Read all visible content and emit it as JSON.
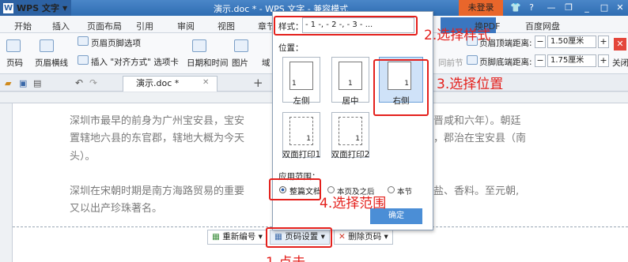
{
  "app": {
    "name": "WPS 文字",
    "doc_title": "演示.doc * - WPS 文字 - 兼容模式",
    "login": "未登录"
  },
  "tabs": [
    "开始",
    "插入",
    "页面布局",
    "引用",
    "审阅",
    "视图",
    "章节",
    "换PDF",
    "百度网盘"
  ],
  "ribbon": {
    "page_number": "页码",
    "header_footer": "页眉横线",
    "header_footer_option": "页眉页脚选项",
    "insert_align_tab": "插入 \"对齐方式\" 选项卡",
    "date_time": "日期和时间",
    "picture": "图片",
    "field": "域",
    "same_prev": "同前节",
    "header_top_label": "页眉顶端距离:",
    "header_top_value": "1.50厘米",
    "footer_bottom_label": "页脚底端距离:",
    "footer_bottom_value": "1.75厘米",
    "close": "关闭"
  },
  "doc_tab": "演示.doc *",
  "document": {
    "line1a": "深圳市最早的前身为广州宝安县，宝安",
    "line1b": "晋咸和六年）。朝廷",
    "line2a": "置辖地六县的东官郡，辖地大概为今天",
    "line2b": "，郡治在宝安县（南",
    "line3": "头）。",
    "line4a": "深圳在宋朝时期是南方海路贸易的重要",
    "line4b": "盐、香料。至元朝,",
    "line5": "又以出产珍珠著名。"
  },
  "popup": {
    "style_label": "样式：",
    "style_value": "- 1 -, - 2 -, - 3 - ...",
    "position_label": "位置：",
    "positions": [
      {
        "label": "左侧",
        "num": "1"
      },
      {
        "label": "居中",
        "num": "1"
      },
      {
        "label": "右侧",
        "num": "1"
      },
      {
        "label": "双面打印1",
        "num": "1"
      },
      {
        "label": "双面打印2",
        "num": "1"
      }
    ],
    "range_label": "应用范围：",
    "ranges": [
      "整篇文档",
      "本页及之后",
      "本节"
    ],
    "ok": "确定"
  },
  "footer_buttons": {
    "renumber": "重新编号",
    "page_settings": "页码设置",
    "delete": "删除页码"
  },
  "annotations": {
    "step1": "1.点击",
    "step2": "2.选择样式",
    "step3": "3.选择位置",
    "step4": "4.选择范围"
  },
  "colors": {
    "annotation": "#e4201c",
    "accent": "#3a76c0",
    "login": "#e9662b"
  }
}
